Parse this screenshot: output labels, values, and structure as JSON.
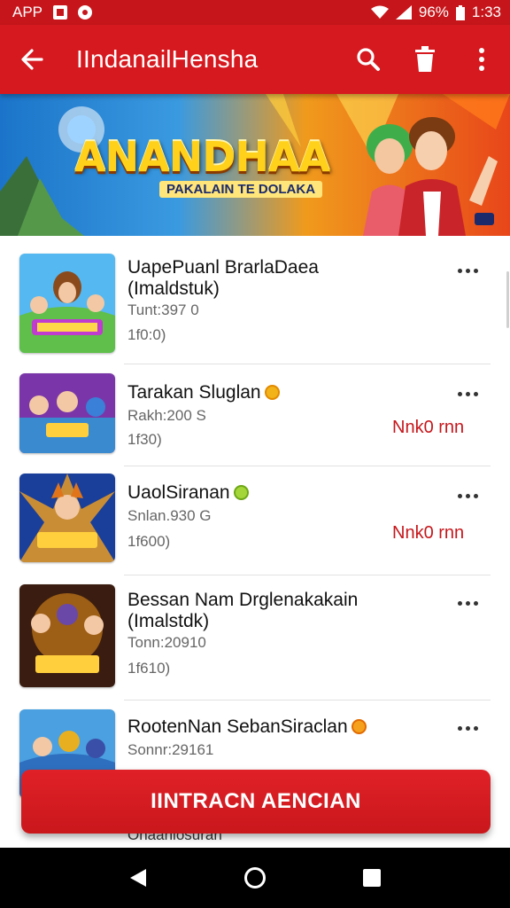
{
  "status_bar": {
    "app_label": "APP",
    "battery": "96%",
    "time": "1:33"
  },
  "app_bar": {
    "title": "IIndanailHensha"
  },
  "banner": {
    "title": "ANANDHAA",
    "subtitle": "PAKALAIN TE DOLAKA",
    "corner_tag": "DB"
  },
  "items": [
    {
      "title_line1": "UapePuanl BrarlaDaea",
      "title_line2": "(Imaldstuk)",
      "meta": "Tunt:397 0",
      "count": "1f0:0)",
      "badge": "",
      "price": ""
    },
    {
      "title_line1": "Tarakan Sluglan",
      "title_line2": "",
      "meta": "Rakh:200 S",
      "count": "1f30)",
      "badge": "gold",
      "price": "Nnk0 rnn"
    },
    {
      "title_line1": "UaolSiranan",
      "title_line2": "",
      "meta": "Snlan.930 G",
      "count": "1f600)",
      "badge": "green",
      "price": "Nnk0 rnn"
    },
    {
      "title_line1": "Bessan Nam Drglenakakain",
      "title_line2": "(Imalstdk)",
      "meta": "Tonn:20910",
      "count": "1f610)",
      "badge": "",
      "price": ""
    },
    {
      "title_line1": "RootenNan SebanSiraclan",
      "title_line2": "",
      "meta": "Sonnr:29161",
      "count": "",
      "badge": "orange",
      "price": ""
    }
  ],
  "peek_text": "Onaanlosuran",
  "cta_label": "IINTRACN AENCIAN",
  "colors": {
    "primary": "#d6191f",
    "status": "#c6161b",
    "price": "#c6161b"
  },
  "icons": [
    "back-arrow-icon",
    "search-icon",
    "delete-icon",
    "more-vert-icon",
    "more-horiz-icon",
    "nav-back-icon",
    "nav-home-icon",
    "nav-recents-icon"
  ]
}
